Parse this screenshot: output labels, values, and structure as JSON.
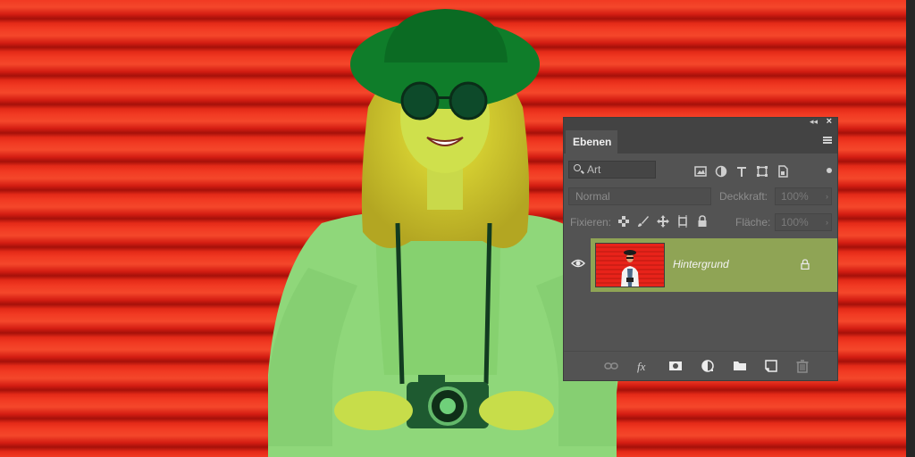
{
  "panel": {
    "tab_label": "Ebenen",
    "filter": {
      "placeholder": "Art"
    },
    "blend_mode": "Normal",
    "opacity": {
      "label": "Deckkraft:",
      "value": "100%"
    },
    "lock": {
      "label": "Fixieren:"
    },
    "fill": {
      "label": "Fläche:",
      "value": "100%"
    },
    "layers": [
      {
        "name": "Hintergrund",
        "visible": true,
        "locked": true,
        "selected": true
      }
    ],
    "filter_icons": [
      "image-filter-icon",
      "adjustment-filter-icon",
      "type-filter-icon",
      "shape-filter-icon",
      "smart-object-filter-icon"
    ],
    "lock_icons": [
      "lock-transparency-icon",
      "lock-image-pixels-icon",
      "lock-position-icon",
      "lock-artboard-icon",
      "lock-all-icon"
    ],
    "bottom_icons": [
      "link-layers-icon",
      "fx-icon",
      "mask-icon",
      "adjustment-layer-icon",
      "folder-icon",
      "new-layer-icon",
      "trash-icon"
    ]
  },
  "colors": {
    "background_red": "#e8231a",
    "panel_bg": "#535353",
    "selected_layer": "#8fa455",
    "figure_green": "#93e07a",
    "hat_green": "#0f7d2a"
  }
}
